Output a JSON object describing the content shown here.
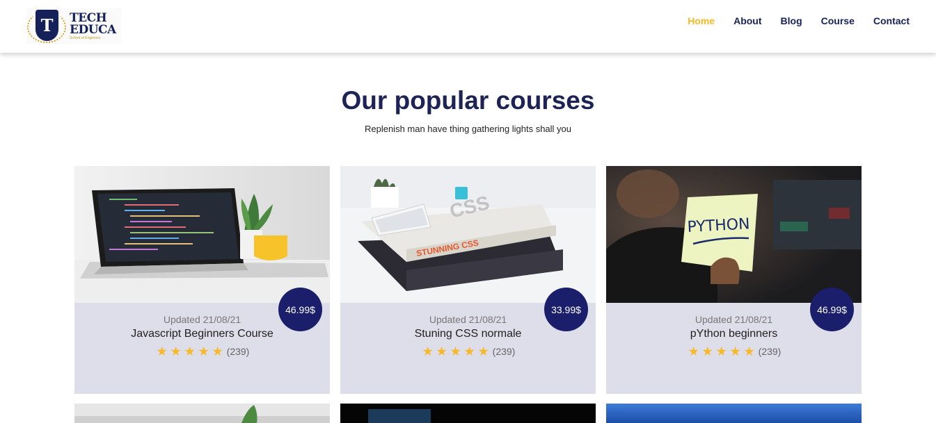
{
  "logo": {
    "line1": "TECH",
    "line2": "EDUCA",
    "line3": "School of Engineers",
    "mark": "T"
  },
  "nav": {
    "items": [
      "Home",
      "About",
      "Blog",
      "Course",
      "Contact"
    ],
    "active": "Home"
  },
  "section": {
    "title": "Our popular courses",
    "subtitle": "Replenish man have thing gathering lights shall you"
  },
  "cards": [
    {
      "image": "laptop-code-photo",
      "price": "46.99$",
      "updated": "Updated 21/08/21",
      "title": "Javascript Beginners Course",
      "stars": 5,
      "count": "(239)"
    },
    {
      "image": "css-books-photo",
      "price": "33.99$",
      "updated": "Updated 21/08/21",
      "title": "Stuning CSS normale",
      "stars": 5,
      "count": "(239)"
    },
    {
      "image": "python-note-photo",
      "price": "46.99$",
      "updated": "Updated 21/08/21",
      "title": "pYthon beginners",
      "stars": 5,
      "count": "(239)"
    }
  ],
  "colors": {
    "brand": "#16215a",
    "accent": "#f7b924",
    "price_bg": "#1a1e6b",
    "card_bg": "#deddea",
    "star": "#f6b92b"
  }
}
